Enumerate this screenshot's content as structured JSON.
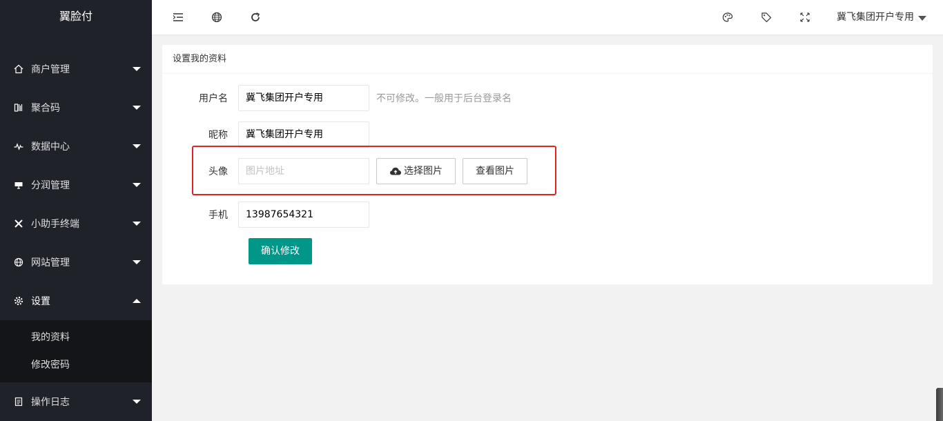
{
  "sidebar": {
    "logo": "翼脸付",
    "items": [
      {
        "label": "商户管理",
        "icon": "home-icon"
      },
      {
        "label": "聚合码",
        "icon": "qrcode-icon"
      },
      {
        "label": "数据中心",
        "icon": "chart-pulse-icon"
      },
      {
        "label": "分润管理",
        "icon": "monitor-icon"
      },
      {
        "label": "小助手终端",
        "icon": "tools-icon"
      },
      {
        "label": "网站管理",
        "icon": "globe-icon"
      },
      {
        "label": "设置",
        "icon": "gear-icon"
      },
      {
        "label": "操作日志",
        "icon": "log-icon"
      }
    ],
    "subitems": [
      {
        "label": "我的资料"
      },
      {
        "label": "修改密码"
      }
    ]
  },
  "header": {
    "user": "冀飞集团开户专用"
  },
  "card": {
    "title": "设置我的资料",
    "username_label": "用户名",
    "username_value": "冀飞集团开户专用",
    "username_tip": "不可修改。一般用于后台登录名",
    "nickname_label": "昵称",
    "nickname_value": "冀飞集团开户专用",
    "avatar_label": "头像",
    "avatar_placeholder": "图片地址",
    "choose_image": "选择图片",
    "view_image": "查看图片",
    "phone_label": "手机",
    "phone_value": "13987654321",
    "submit": "确认修改"
  },
  "colors": {
    "sidebar_bg": "#20222a",
    "primary": "#009688",
    "highlight": "#e02222"
  }
}
